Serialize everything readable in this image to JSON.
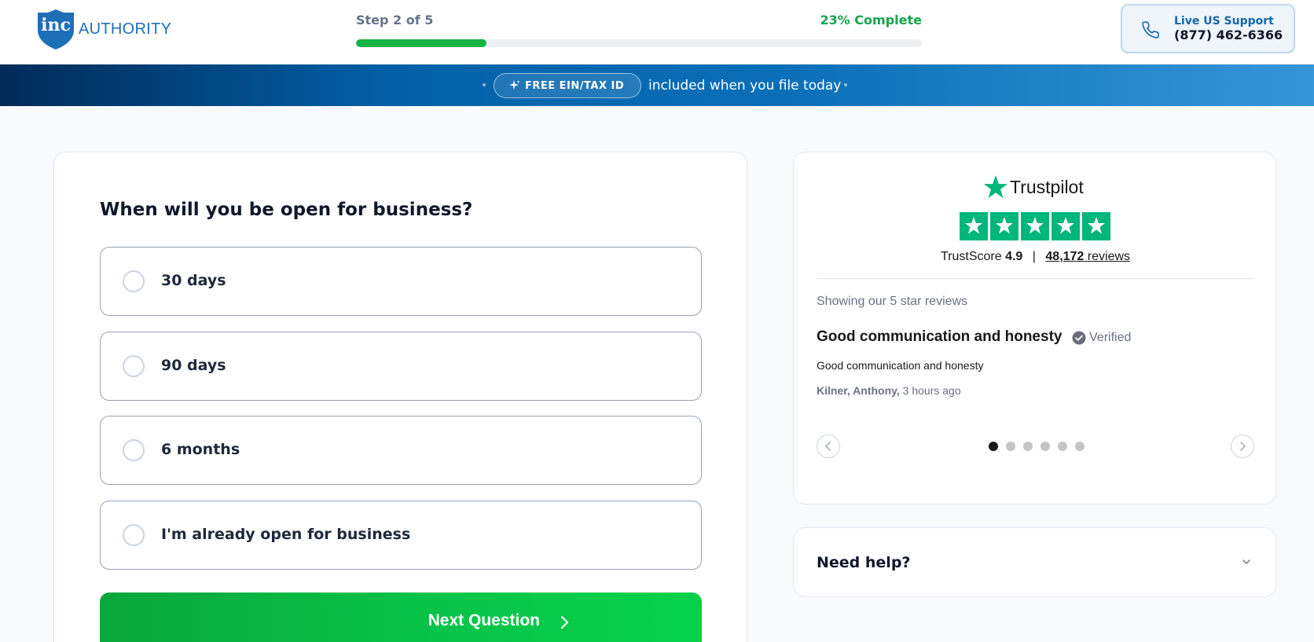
{
  "header": {
    "logo": {
      "mark_text": "inc",
      "brand_text": "AUTHORITY"
    },
    "progress": {
      "step_text": "Step 2 of 5",
      "complete_text": "23% Complete",
      "percent": 23
    },
    "support": {
      "label": "Live US Support",
      "phone": "(877) 462-6366"
    }
  },
  "banner": {
    "pill_label": "FREE EIN/TAX ID",
    "text": "included when you file today"
  },
  "form": {
    "question": "When will you be open for business?",
    "options": [
      {
        "label": "30 days"
      },
      {
        "label": "90 days"
      },
      {
        "label": "6 months"
      },
      {
        "label": "I'm already open for business"
      }
    ],
    "next_label": "Next Question"
  },
  "trustpilot": {
    "brand": "Trustpilot",
    "stars": 5,
    "score_label": "TrustScore",
    "score": "4.9",
    "separator": "|",
    "review_count": "48,172",
    "reviews_word": "reviews",
    "showing_text": "Showing our 5 star reviews",
    "review": {
      "title": "Good communication and honesty",
      "verified_label": "Verified",
      "body": "Good communication and honesty",
      "author": "Kilner, Anthony,",
      "time": "3 hours ago"
    },
    "dots_count": 6,
    "active_dot": 0
  },
  "help": {
    "label": "Need help?"
  },
  "colors": {
    "brand_blue": "#1d6fb8",
    "progress_green": "#13b345",
    "trustpilot_green": "#00b67a",
    "cta_green": "#08c54a"
  }
}
